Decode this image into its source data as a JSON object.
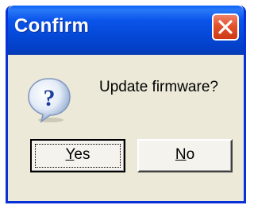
{
  "window": {
    "title": "Confirm"
  },
  "dialog": {
    "message": "Update firmware?",
    "icon": "question-icon"
  },
  "buttons": {
    "yes": {
      "accel": "Y",
      "rest": "es"
    },
    "no": {
      "accel": "N",
      "rest": "o"
    }
  },
  "colors": {
    "titlebar": "#0549d8",
    "frame": "#0831d9",
    "body": "#ece9d8",
    "close": "#e2522c"
  }
}
